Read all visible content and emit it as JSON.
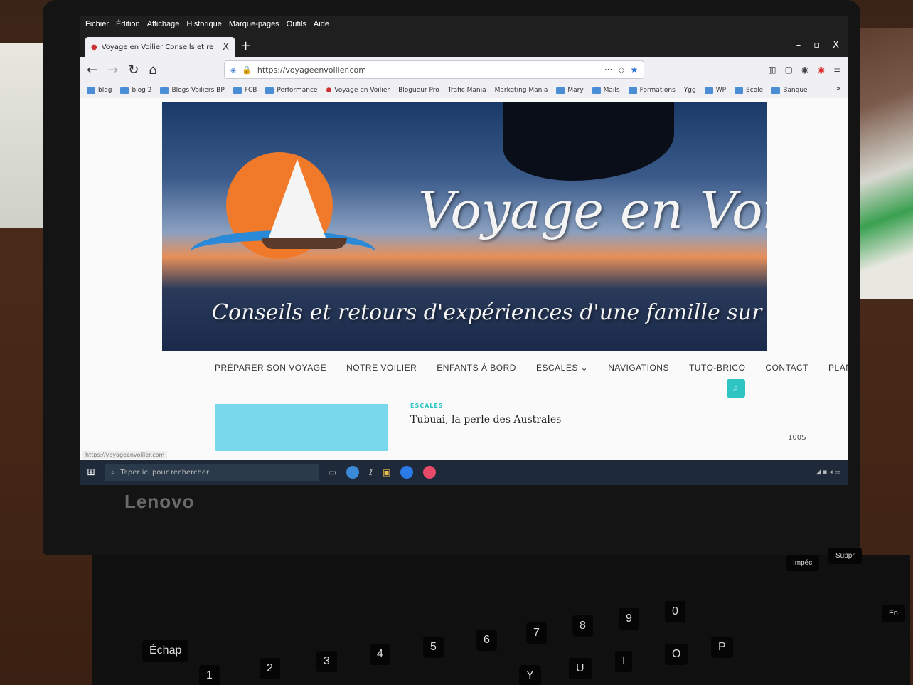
{
  "browser": {
    "menu": [
      "Fichier",
      "Édition",
      "Affichage",
      "Historique",
      "Marque-pages",
      "Outils",
      "Aide"
    ],
    "tab_title": "Voyage en Voilier Conseils et re",
    "tab_close": "X",
    "new_tab": "+",
    "window_controls": [
      "–",
      "▫",
      "X"
    ],
    "url": "https://voyageenvoilier.com",
    "url_actions": "···",
    "bookmarks": [
      "blog",
      "blog 2",
      "Blogs Voiliers BP",
      "FCB",
      "Performance",
      "Voyage en Voilier",
      "Blogueur Pro",
      "Trafic Mania",
      "Marketing Mania",
      "Mary",
      "Mails",
      "Formations",
      "Ygg",
      "WP",
      "Ecole",
      "Banque"
    ],
    "bookmarks_more": "»",
    "status_url": "https://voyageenvoilier.com"
  },
  "site": {
    "title": "Voyage en Voilier",
    "tagline": "Conseils et retours d'expériences d'une famille sur la mer.",
    "nav": [
      "PRÉPARER SON VOYAGE",
      "NOTRE VOILIER",
      "ENFANTS À BORD",
      "ESCALES ⌄",
      "NAVIGATIONS",
      "TUTO-BRICO",
      "CONTACT",
      "PLAN DU SITE"
    ],
    "post_category": "ESCALES",
    "post_title": "Tubuai, la perle des Australes"
  },
  "taskbar": {
    "search_placeholder": "Taper ici pour rechercher"
  },
  "device": {
    "brand": "Lenovo",
    "model": "100S",
    "keys": [
      "Échap",
      "1",
      "2",
      "3",
      "4",
      "5",
      "6",
      "7",
      "8",
      "9",
      "0",
      "Y",
      "U",
      "I",
      "O",
      "P",
      "Fn",
      "Impéc",
      "Suppr"
    ]
  },
  "colors": {
    "accent": "#2ec4c4",
    "sun": "#f07a2a",
    "thumb": "#7ad8ec"
  }
}
